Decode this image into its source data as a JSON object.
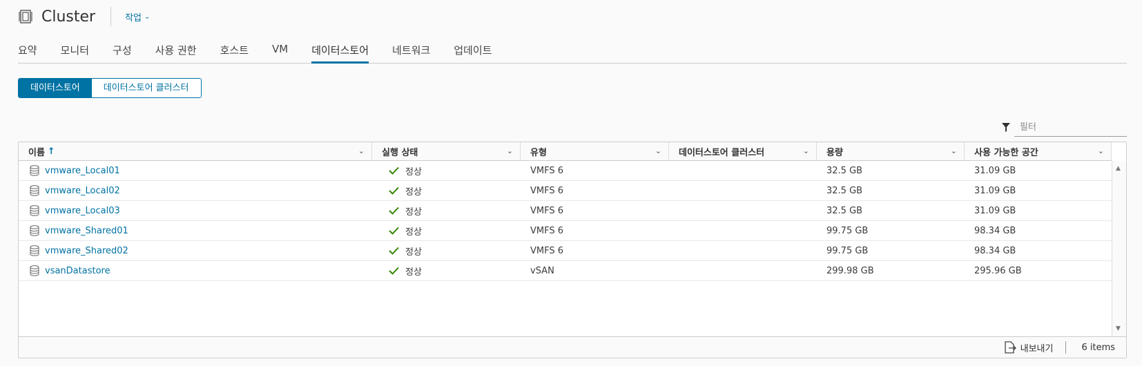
{
  "header": {
    "title": "Cluster",
    "actions_label": "작업"
  },
  "tabs": [
    {
      "label": "요약"
    },
    {
      "label": "모니터"
    },
    {
      "label": "구성"
    },
    {
      "label": "사용 권한"
    },
    {
      "label": "호스트"
    },
    {
      "label": "VM"
    },
    {
      "label": "데이터스토어"
    },
    {
      "label": "네트워크"
    },
    {
      "label": "업데이트"
    }
  ],
  "active_tab": "데이터스토어",
  "segment": {
    "datastores": "데이터스토어",
    "datastore_clusters": "데이터스토어 클러스터"
  },
  "filter": {
    "placeholder": "필터"
  },
  "grid": {
    "columns": [
      "이름",
      "실행 상태",
      "유형",
      "데이터스토어 클러스터",
      "용량",
      "사용 가능한 공간"
    ],
    "rows": [
      {
        "name": "vmware_Local01",
        "status": "정상",
        "type": "VMFS 6",
        "cluster": "",
        "capacity": "32.5 GB",
        "free": "31.09 GB"
      },
      {
        "name": "vmware_Local02",
        "status": "정상",
        "type": "VMFS 6",
        "cluster": "",
        "capacity": "32.5 GB",
        "free": "31.09 GB"
      },
      {
        "name": "vmware_Local03",
        "status": "정상",
        "type": "VMFS 6",
        "cluster": "",
        "capacity": "32.5 GB",
        "free": "31.09 GB"
      },
      {
        "name": "vmware_Shared01",
        "status": "정상",
        "type": "VMFS 6",
        "cluster": "",
        "capacity": "99.75 GB",
        "free": "98.34 GB"
      },
      {
        "name": "vmware_Shared02",
        "status": "정상",
        "type": "VMFS 6",
        "cluster": "",
        "capacity": "99.75 GB",
        "free": "98.34 GB"
      },
      {
        "name": "vsanDatastore",
        "status": "정상",
        "type": "vSAN",
        "cluster": "",
        "capacity": "299.98 GB",
        "free": "295.96 GB"
      }
    ],
    "footer": {
      "export_label": "내보내기",
      "count": "6 items"
    }
  },
  "colors": {
    "accent": "#0072a3",
    "ok": "#2f8400"
  },
  "icons": {
    "cluster": "cluster-icon",
    "datastore": "datastore-icon",
    "status_ok": "check-icon",
    "filter": "filter-icon",
    "export": "export-icon",
    "sort": "sort-asc-icon"
  }
}
